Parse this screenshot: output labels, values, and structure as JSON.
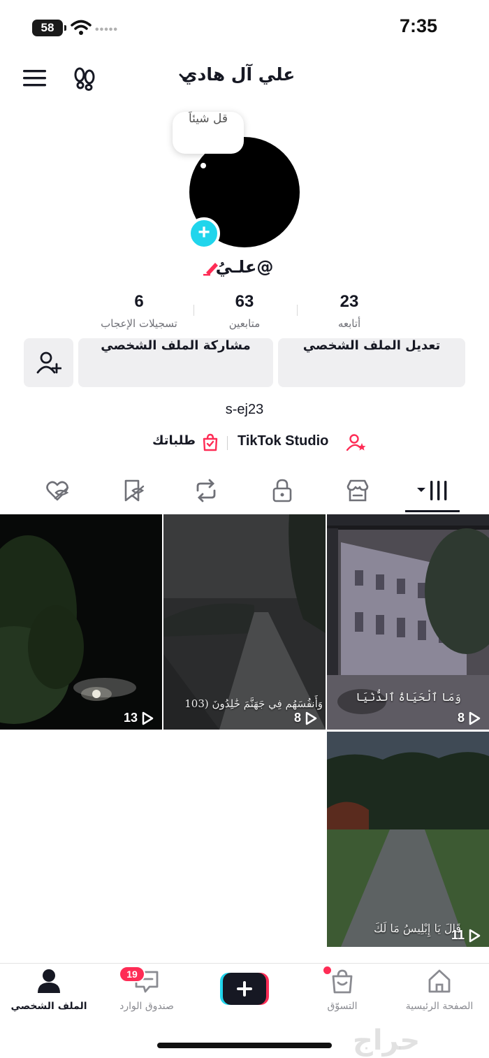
{
  "status_bar": {
    "battery": "58",
    "time": "7:35"
  },
  "header": {
    "title": "علي آل هادي"
  },
  "profile": {
    "bubble_text": "قل شيئاَ",
    "username": "@علـيُ",
    "stats": [
      {
        "value": "23",
        "label": "أتابعه"
      },
      {
        "value": "63",
        "label": "متابعين"
      },
      {
        "value": "6",
        "label": "تسجيلات الإعجاب"
      }
    ],
    "edit_label": "تعديل الملف الشخصي",
    "share_label": "مشاركة الملف الشخصي",
    "handle": "s-ej23",
    "studio_label": "TikTok Studio",
    "orders_label": "طلباتك"
  },
  "videos": [
    {
      "views": "13",
      "caption": ""
    },
    {
      "views": "8",
      "caption": "وَأَنفُسَهُم فِي جَهَنَّمَ خَٰلِدُونَ (103"
    },
    {
      "views": "8",
      "caption": "وَمَا ٱلْحَيَاةُ ٱلدُّنْيَا"
    },
    {
      "views": "11",
      "caption": "قَالَ يَا إِبْلِيسُ مَا لَكَ"
    }
  ],
  "bottom_nav": {
    "home": "الصفحة الرئيسية",
    "shop": "التسوّق",
    "inbox": "صندوق الوارد",
    "inbox_count": "19",
    "profile": "الملف الشخصي"
  },
  "watermark": "حراج",
  "colors": {
    "accent_cyan": "#20d5ec",
    "accent_red": "#fe2c55",
    "button_gray": "#efeff1"
  }
}
